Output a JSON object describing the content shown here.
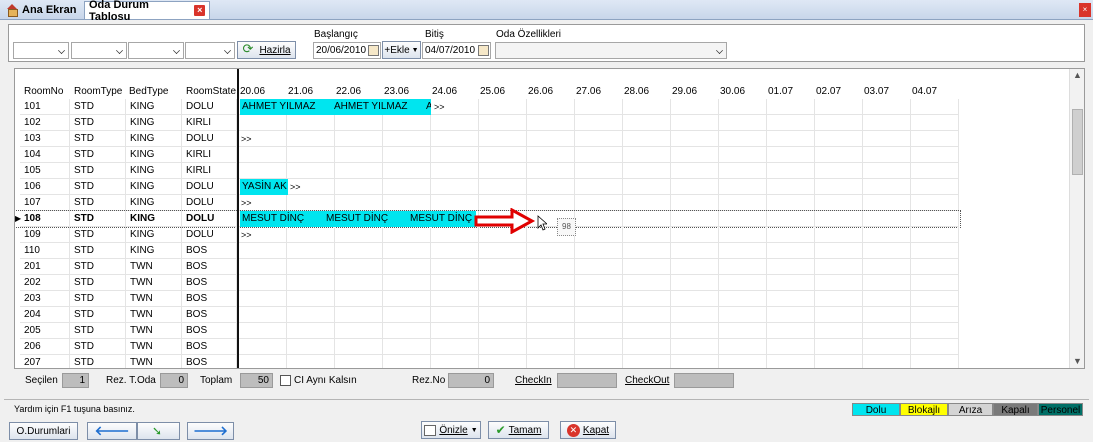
{
  "tabs": [
    {
      "label": "Ana Ekran"
    },
    {
      "label": "Oda Durum Tablosu"
    }
  ],
  "filters": {
    "refresh_label": "Hazirla",
    "start_label": "Başlangıç",
    "start_value": "20/06/2010",
    "add_label": "+Ekle",
    "end_label": "Bitiş",
    "end_value": "04/07/2010",
    "features_label": "Oda Özellikleri"
  },
  "grid": {
    "headers": [
      "RoomNo",
      "RoomType",
      "BedType",
      "RoomState"
    ],
    "dates": [
      "20.06",
      "21.06",
      "22.06",
      "23.06",
      "24.06",
      "25.06",
      "26.06",
      "27.06",
      "28.06",
      "29.06",
      "30.06",
      "01.07",
      "02.07",
      "03.07",
      "04.07"
    ],
    "rows": [
      {
        "no": "101",
        "type": "STD",
        "bed": "KING",
        "state": "DOLU"
      },
      {
        "no": "102",
        "type": "STD",
        "bed": "KING",
        "state": "KIRLI"
      },
      {
        "no": "103",
        "type": "STD",
        "bed": "KING",
        "state": "DOLU"
      },
      {
        "no": "104",
        "type": "STD",
        "bed": "KING",
        "state": "KIRLI"
      },
      {
        "no": "105",
        "type": "STD",
        "bed": "KING",
        "state": "KIRLI"
      },
      {
        "no": "106",
        "type": "STD",
        "bed": "KING",
        "state": "DOLU"
      },
      {
        "no": "107",
        "type": "STD",
        "bed": "KING",
        "state": "DOLU"
      },
      {
        "no": "108",
        "type": "STD",
        "bed": "KING",
        "state": "DOLU"
      },
      {
        "no": "109",
        "type": "STD",
        "bed": "KING",
        "state": "DOLU"
      },
      {
        "no": "110",
        "type": "STD",
        "bed": "KING",
        "state": "BOS"
      },
      {
        "no": "201",
        "type": "STD",
        "bed": "TWN",
        "state": "BOS"
      },
      {
        "no": "202",
        "type": "STD",
        "bed": "TWN",
        "state": "BOS"
      },
      {
        "no": "203",
        "type": "STD",
        "bed": "TWN",
        "state": "BOS"
      },
      {
        "no": "204",
        "type": "STD",
        "bed": "TWN",
        "state": "BOS"
      },
      {
        "no": "205",
        "type": "STD",
        "bed": "TWN",
        "state": "BOS"
      },
      {
        "no": "206",
        "type": "STD",
        "bed": "TWN",
        "state": "BOS"
      },
      {
        "no": "207",
        "type": "STD",
        "bed": "TWN",
        "state": "BOS"
      }
    ],
    "bookings": {
      "b101a": "AHMET YILMAZ",
      "b101b": "AHMET YILMAZ",
      "b101c": "A",
      "b106": "YASİN AK",
      "b108a": "MESUT DİNÇ",
      "b108b": "MESUT DİNÇ",
      "b108c": "MESUT DİNÇ",
      "more": ">>",
      "drag_tip": "98"
    }
  },
  "stats": {
    "selected_label": "Seçilen",
    "selected_value": "1",
    "rez_oda_label": "Rez. T.Oda",
    "rez_oda_value": "0",
    "total_label": "Toplam",
    "total_value": "50",
    "keep_label": "CI Aynı Kalsın",
    "rezno_label": "Rez.No",
    "rezno_value": "0",
    "checkin_label": "CheckIn",
    "checkout_label": "CheckOut"
  },
  "status": {
    "help_text": "Yardım için F1 tuşuna basınız.",
    "legend": [
      {
        "label": "Dolu",
        "color": "#00e5ef"
      },
      {
        "label": "Blokajlı",
        "color": "#ffff00"
      },
      {
        "label": "Arıza",
        "color": "#d4d4d4"
      },
      {
        "label": "Kapalı",
        "color": "#7a7a7a"
      },
      {
        "label": "Personel",
        "color": "#006f66"
      }
    ]
  },
  "toolbar": {
    "status_button": "O.Durumlari",
    "preview_button": "Önizle",
    "ok_button": "Tamam",
    "close_button": "Kapat"
  },
  "colors": {
    "booking": "#00e5ef",
    "arrow": "#e00000"
  }
}
